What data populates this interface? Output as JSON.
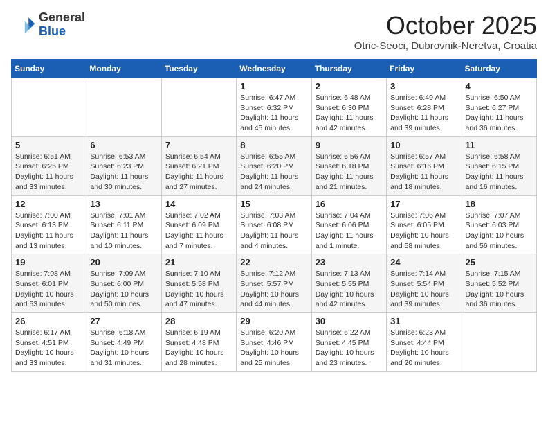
{
  "header": {
    "logo_general": "General",
    "logo_blue": "Blue",
    "month_title": "October 2025",
    "subtitle": "Otric-Seoci, Dubrovnik-Neretva, Croatia"
  },
  "weekdays": [
    "Sunday",
    "Monday",
    "Tuesday",
    "Wednesday",
    "Thursday",
    "Friday",
    "Saturday"
  ],
  "weeks": [
    [
      {
        "day": "",
        "info": ""
      },
      {
        "day": "",
        "info": ""
      },
      {
        "day": "",
        "info": ""
      },
      {
        "day": "1",
        "info": "Sunrise: 6:47 AM\nSunset: 6:32 PM\nDaylight: 11 hours and 45 minutes."
      },
      {
        "day": "2",
        "info": "Sunrise: 6:48 AM\nSunset: 6:30 PM\nDaylight: 11 hours and 42 minutes."
      },
      {
        "day": "3",
        "info": "Sunrise: 6:49 AM\nSunset: 6:28 PM\nDaylight: 11 hours and 39 minutes."
      },
      {
        "day": "4",
        "info": "Sunrise: 6:50 AM\nSunset: 6:27 PM\nDaylight: 11 hours and 36 minutes."
      }
    ],
    [
      {
        "day": "5",
        "info": "Sunrise: 6:51 AM\nSunset: 6:25 PM\nDaylight: 11 hours and 33 minutes."
      },
      {
        "day": "6",
        "info": "Sunrise: 6:53 AM\nSunset: 6:23 PM\nDaylight: 11 hours and 30 minutes."
      },
      {
        "day": "7",
        "info": "Sunrise: 6:54 AM\nSunset: 6:21 PM\nDaylight: 11 hours and 27 minutes."
      },
      {
        "day": "8",
        "info": "Sunrise: 6:55 AM\nSunset: 6:20 PM\nDaylight: 11 hours and 24 minutes."
      },
      {
        "day": "9",
        "info": "Sunrise: 6:56 AM\nSunset: 6:18 PM\nDaylight: 11 hours and 21 minutes."
      },
      {
        "day": "10",
        "info": "Sunrise: 6:57 AM\nSunset: 6:16 PM\nDaylight: 11 hours and 18 minutes."
      },
      {
        "day": "11",
        "info": "Sunrise: 6:58 AM\nSunset: 6:15 PM\nDaylight: 11 hours and 16 minutes."
      }
    ],
    [
      {
        "day": "12",
        "info": "Sunrise: 7:00 AM\nSunset: 6:13 PM\nDaylight: 11 hours and 13 minutes."
      },
      {
        "day": "13",
        "info": "Sunrise: 7:01 AM\nSunset: 6:11 PM\nDaylight: 11 hours and 10 minutes."
      },
      {
        "day": "14",
        "info": "Sunrise: 7:02 AM\nSunset: 6:09 PM\nDaylight: 11 hours and 7 minutes."
      },
      {
        "day": "15",
        "info": "Sunrise: 7:03 AM\nSunset: 6:08 PM\nDaylight: 11 hours and 4 minutes."
      },
      {
        "day": "16",
        "info": "Sunrise: 7:04 AM\nSunset: 6:06 PM\nDaylight: 11 hours and 1 minute."
      },
      {
        "day": "17",
        "info": "Sunrise: 7:06 AM\nSunset: 6:05 PM\nDaylight: 10 hours and 58 minutes."
      },
      {
        "day": "18",
        "info": "Sunrise: 7:07 AM\nSunset: 6:03 PM\nDaylight: 10 hours and 56 minutes."
      }
    ],
    [
      {
        "day": "19",
        "info": "Sunrise: 7:08 AM\nSunset: 6:01 PM\nDaylight: 10 hours and 53 minutes."
      },
      {
        "day": "20",
        "info": "Sunrise: 7:09 AM\nSunset: 6:00 PM\nDaylight: 10 hours and 50 minutes."
      },
      {
        "day": "21",
        "info": "Sunrise: 7:10 AM\nSunset: 5:58 PM\nDaylight: 10 hours and 47 minutes."
      },
      {
        "day": "22",
        "info": "Sunrise: 7:12 AM\nSunset: 5:57 PM\nDaylight: 10 hours and 44 minutes."
      },
      {
        "day": "23",
        "info": "Sunrise: 7:13 AM\nSunset: 5:55 PM\nDaylight: 10 hours and 42 minutes."
      },
      {
        "day": "24",
        "info": "Sunrise: 7:14 AM\nSunset: 5:54 PM\nDaylight: 10 hours and 39 minutes."
      },
      {
        "day": "25",
        "info": "Sunrise: 7:15 AM\nSunset: 5:52 PM\nDaylight: 10 hours and 36 minutes."
      }
    ],
    [
      {
        "day": "26",
        "info": "Sunrise: 6:17 AM\nSunset: 4:51 PM\nDaylight: 10 hours and 33 minutes."
      },
      {
        "day": "27",
        "info": "Sunrise: 6:18 AM\nSunset: 4:49 PM\nDaylight: 10 hours and 31 minutes."
      },
      {
        "day": "28",
        "info": "Sunrise: 6:19 AM\nSunset: 4:48 PM\nDaylight: 10 hours and 28 minutes."
      },
      {
        "day": "29",
        "info": "Sunrise: 6:20 AM\nSunset: 4:46 PM\nDaylight: 10 hours and 25 minutes."
      },
      {
        "day": "30",
        "info": "Sunrise: 6:22 AM\nSunset: 4:45 PM\nDaylight: 10 hours and 23 minutes."
      },
      {
        "day": "31",
        "info": "Sunrise: 6:23 AM\nSunset: 4:44 PM\nDaylight: 10 hours and 20 minutes."
      },
      {
        "day": "",
        "info": ""
      }
    ]
  ]
}
